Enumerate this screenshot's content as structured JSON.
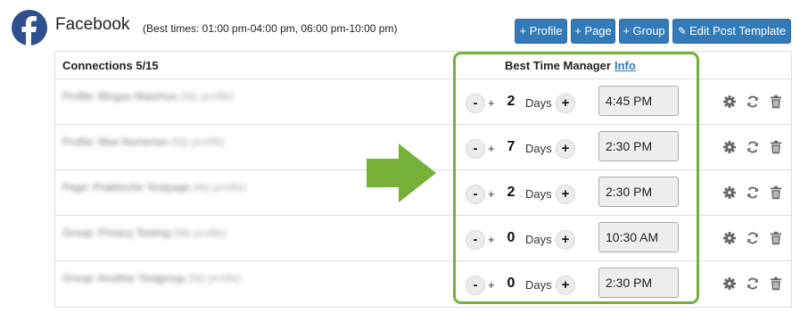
{
  "header": {
    "title": "Facebook",
    "best_times": "(Best times: 01:00 pm-04:00 pm, 06:00 pm-10:00 pm)"
  },
  "buttons": {
    "profile": "+ Profile",
    "page": "+ Page",
    "group": "+ Group",
    "edit_template": "Edit Post Template"
  },
  "table": {
    "connections_label": "Connections 5/15",
    "btm_label": "Best Time Manager",
    "btm_info": "Info",
    "rows": [
      {
        "name": "Profile: Blogus Maximus",
        "meta": "(My profile)",
        "days": "2",
        "days_label": "Days",
        "time": "4:45 PM"
      },
      {
        "name": "Profile: Max Numerion",
        "meta": "(My profile)",
        "days": "7",
        "days_label": "Days",
        "time": "2:30 PM"
      },
      {
        "name": "Page: Praktische Testpage",
        "meta": "(My profile)",
        "days": "2",
        "days_label": "Days",
        "time": "2:30 PM"
      },
      {
        "name": "Group: Privacy Testing",
        "meta": "(My profile)",
        "days": "0",
        "days_label": "Days",
        "time": "10:30 AM"
      },
      {
        "name": "Group: Another Testgroup",
        "meta": "(My profile)",
        "days": "0",
        "days_label": "Days",
        "time": "2:30 PM"
      }
    ]
  },
  "colors": {
    "button_bg": "#337ab7",
    "highlight": "#76b038",
    "facebook_logo": "#2f4f8f"
  }
}
